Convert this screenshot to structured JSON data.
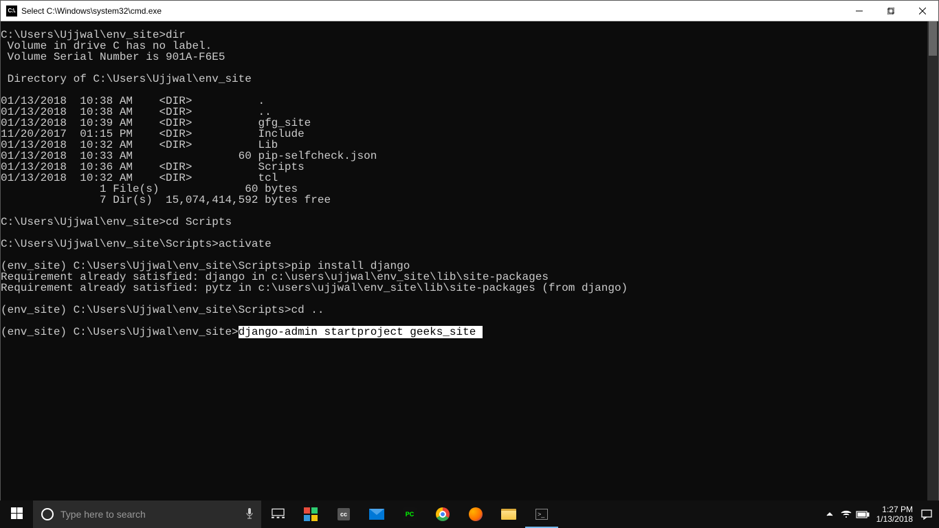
{
  "window": {
    "title": "Select C:\\Windows\\system32\\cmd.exe",
    "icon_text": "C:\\."
  },
  "terminal": {
    "lines": [
      "C:\\Users\\Ujjwal\\env_site>dir",
      " Volume in drive C has no label.",
      " Volume Serial Number is 901A-F6E5",
      "",
      " Directory of C:\\Users\\Ujjwal\\env_site",
      "",
      "01/13/2018  10:38 AM    <DIR>          .",
      "01/13/2018  10:38 AM    <DIR>          ..",
      "01/13/2018  10:39 AM    <DIR>          gfg_site",
      "11/20/2017  01:15 PM    <DIR>          Include",
      "01/13/2018  10:32 AM    <DIR>          Lib",
      "01/13/2018  10:33 AM                60 pip-selfcheck.json",
      "01/13/2018  10:36 AM    <DIR>          Scripts",
      "01/13/2018  10:32 AM    <DIR>          tcl",
      "               1 File(s)             60 bytes",
      "               7 Dir(s)  15,074,414,592 bytes free",
      "",
      "C:\\Users\\Ujjwal\\env_site>cd Scripts",
      "",
      "C:\\Users\\Ujjwal\\env_site\\Scripts>activate",
      "",
      "(env_site) C:\\Users\\Ujjwal\\env_site\\Scripts>pip install django",
      "Requirement already satisfied: django in c:\\users\\ujjwal\\env_site\\lib\\site-packages",
      "Requirement already satisfied: pytz in c:\\users\\ujjwal\\env_site\\lib\\site-packages (from django)",
      "",
      "(env_site) C:\\Users\\Ujjwal\\env_site\\Scripts>cd ..",
      ""
    ],
    "last_prompt": "(env_site) C:\\Users\\Ujjwal\\env_site>",
    "last_command_selected": "django-admin startproject geeks_site "
  },
  "taskbar": {
    "search_placeholder": "Type here to search",
    "time": "1:27 PM",
    "date": "1/13/2018"
  }
}
